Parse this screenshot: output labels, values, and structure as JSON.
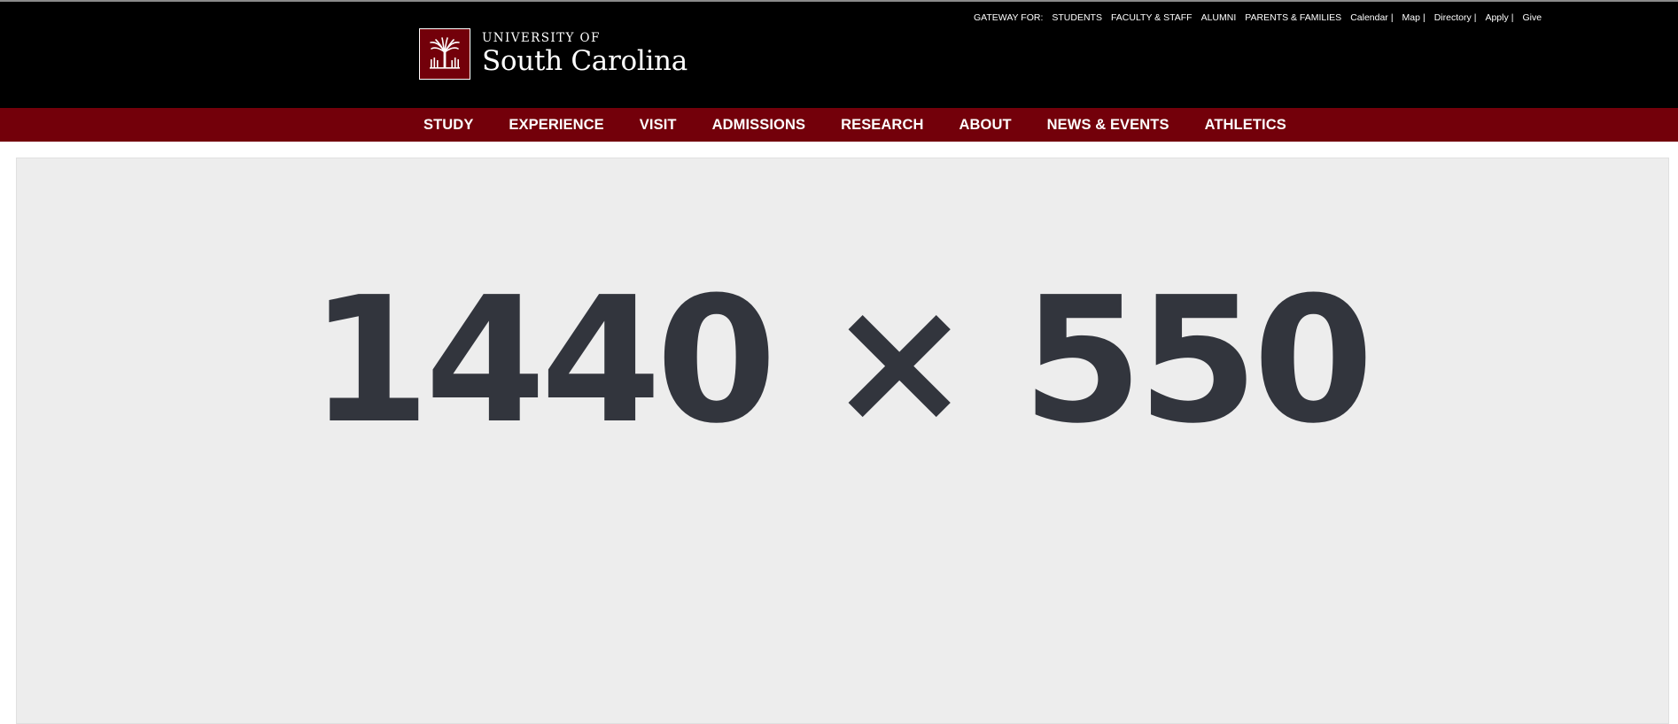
{
  "utility_nav": {
    "gateway_label": "GATEWAY FOR:",
    "audiences": [
      "STUDENTS",
      "FACULTY & STAFF",
      "ALUMNI",
      "PARENTS & FAMILIES"
    ],
    "links": [
      {
        "label": "Calendar",
        "sep": "|"
      },
      {
        "label": "Map",
        "sep": "|"
      },
      {
        "label": "Directory",
        "sep": "|"
      },
      {
        "label": "Apply",
        "sep": "|"
      },
      {
        "label": "Give",
        "sep": ""
      }
    ]
  },
  "brand": {
    "line1": "UNIVERSITY OF",
    "line2": "South Carolina",
    "seal_icon": "palmetto-tree-icon"
  },
  "main_nav": {
    "items": [
      "STUDY",
      "EXPERIENCE",
      "VISIT",
      "ADMISSIONS",
      "RESEARCH",
      "ABOUT",
      "NEWS & EVENTS",
      "ATHLETICS"
    ]
  },
  "hero": {
    "placeholder_text": "1440 × 550"
  },
  "colors": {
    "garnet": "#73000a",
    "topbar": "#000000",
    "hero_bg": "#ededed",
    "hero_text": "#32353d"
  }
}
